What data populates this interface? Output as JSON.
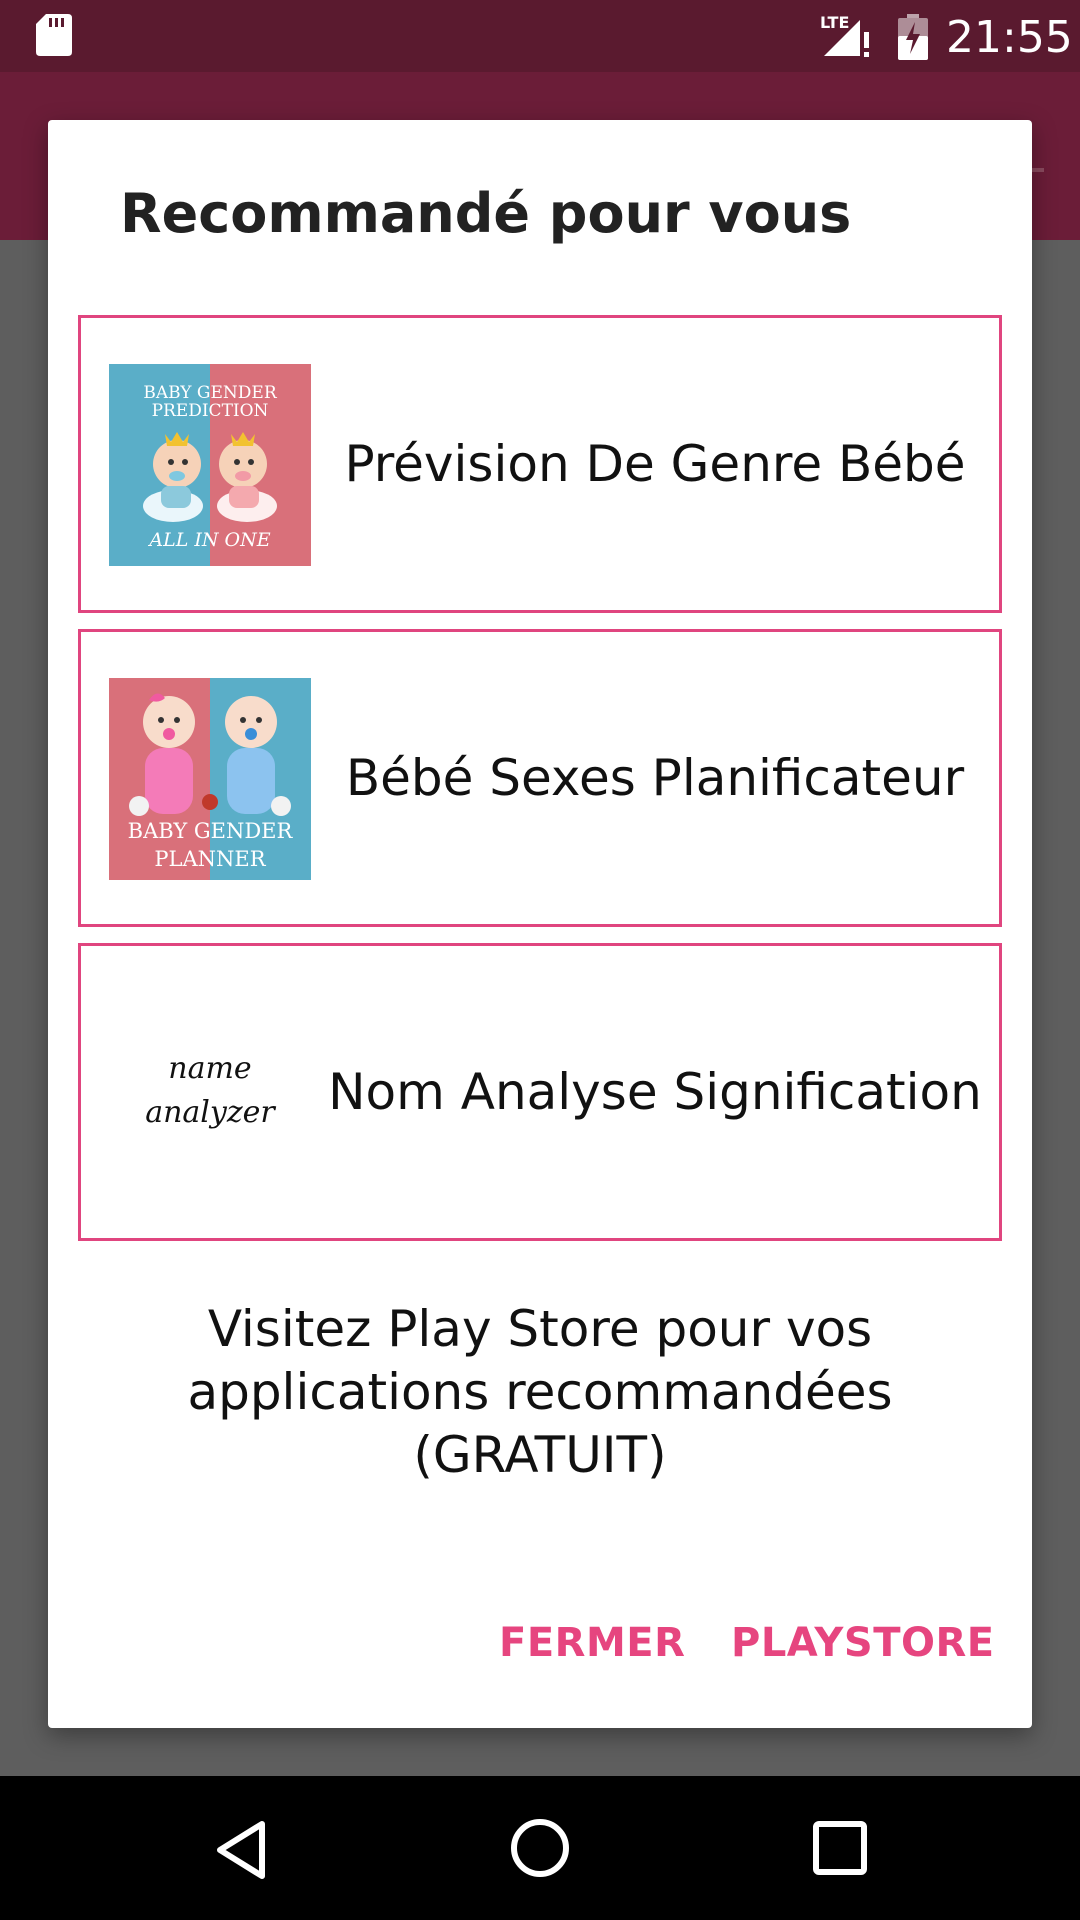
{
  "status_bar": {
    "time": "21:55",
    "network_label": "LTE",
    "icons": [
      "sd-card-icon",
      "lte-signal-icon",
      "battery-charging-icon"
    ]
  },
  "dialog": {
    "title": "Recommandé pour vous",
    "apps": [
      {
        "name": "Prévision De Genre Bébé",
        "icon": "baby-gender-prediction-icon",
        "icon_text": [
          "BABY GENDER",
          "PREDICTION",
          "ALL IN ONE"
        ]
      },
      {
        "name": "Bébé Sexes Planificateur",
        "icon": "baby-gender-planner-icon",
        "icon_text": [
          "BABY GENDER",
          "PLANNER"
        ]
      },
      {
        "name": "Nom Analyse Signification",
        "icon": "name-analyzer-icon",
        "icon_text": [
          "name",
          "analyzer"
        ]
      }
    ],
    "message": "Visitez Play Store pour vos applications recommandées (GRATUIT)",
    "buttons": {
      "close": "FERMER",
      "store": "PLAYSTORE"
    }
  },
  "colors": {
    "status_bar": "#5a1a2f",
    "app_bar": "#6b1d38",
    "accent": "#e6457f",
    "card_border": "#e0457f",
    "scrim": "#5e5e5e",
    "icon_blue": "#5aaec8",
    "icon_red": "#d9707a"
  },
  "nav_bar": {
    "icons": [
      "back-icon",
      "home-icon",
      "recents-icon"
    ]
  }
}
